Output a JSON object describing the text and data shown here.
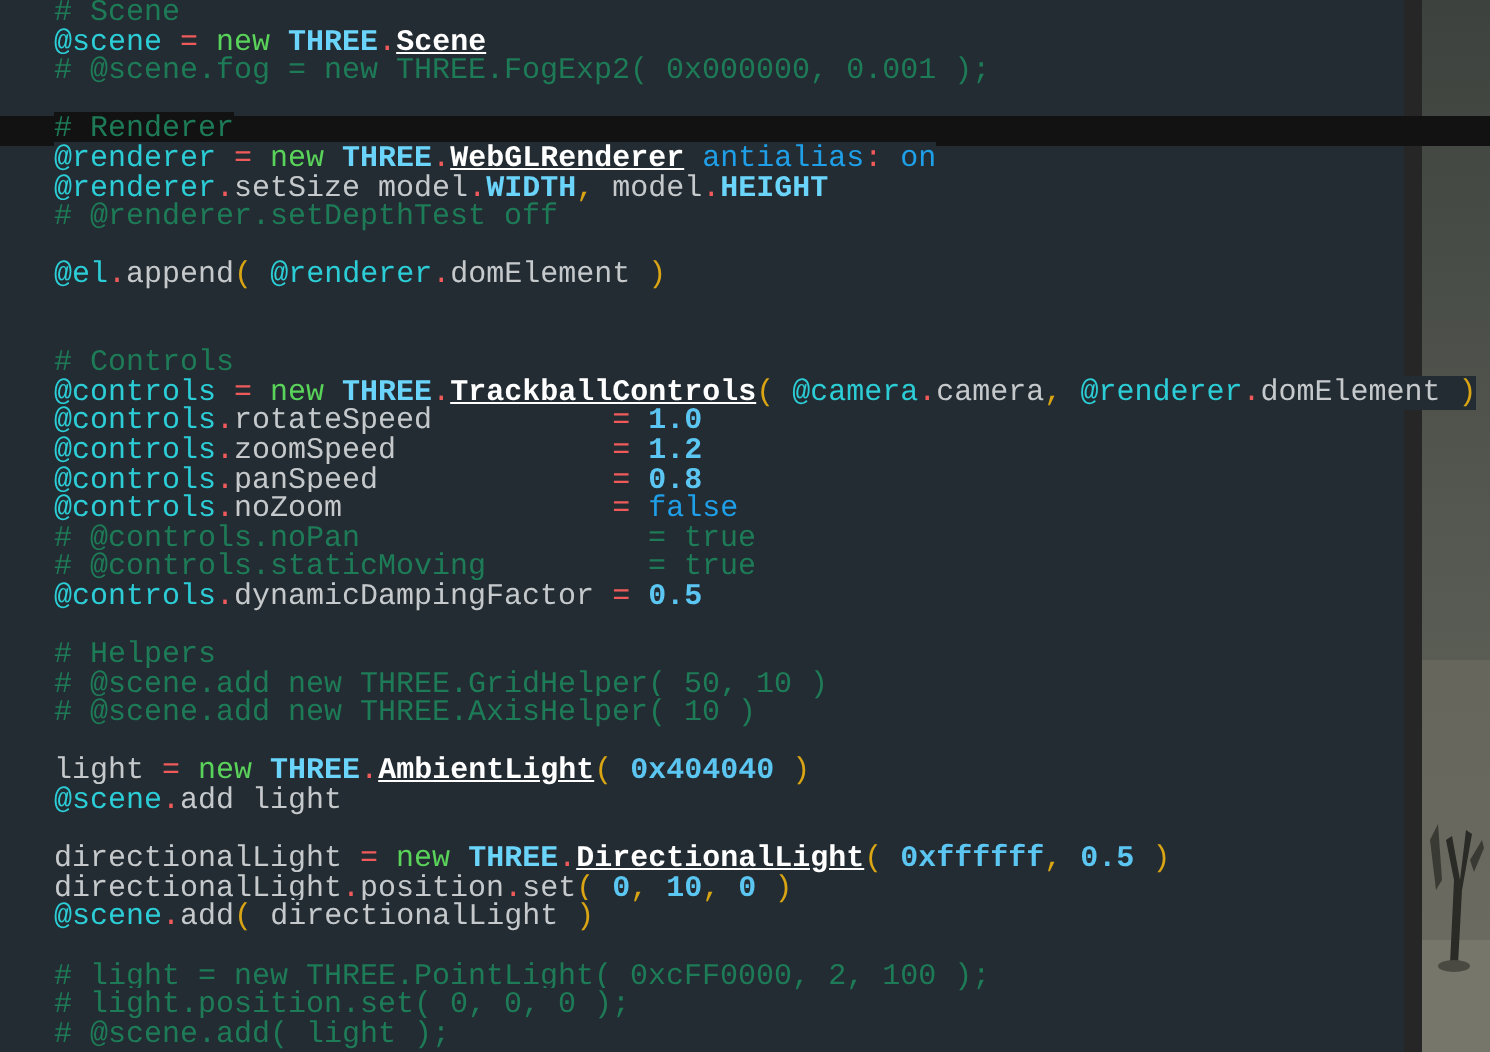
{
  "editor": {
    "lines": [
      {
        "kind": "code",
        "selected": false,
        "tokens": [
          {
            "text": "# Scene",
            "kind": "comment"
          }
        ]
      },
      {
        "kind": "code",
        "selected": false,
        "tokens": [
          {
            "text": "@scene",
            "kind": "ivar"
          },
          {
            "text": " = ",
            "kind": "op"
          },
          {
            "text": "new ",
            "kind": "new"
          },
          {
            "text": "THREE",
            "kind": "const"
          },
          {
            "text": ".",
            "kind": "op"
          },
          {
            "text": "Scene",
            "kind": "class"
          }
        ]
      },
      {
        "kind": "code",
        "selected": false,
        "tokens": [
          {
            "text": "# @scene.fog = new THREE.FogExp2( 0x000000, 0.001 );",
            "kind": "comment"
          }
        ]
      },
      {
        "kind": "blank",
        "selected": false
      },
      {
        "kind": "code",
        "selected": true,
        "tokens": [
          {
            "text": "# Renderer",
            "kind": "comment"
          }
        ]
      },
      {
        "kind": "code",
        "selected": false,
        "tokens": [
          {
            "text": "@renderer",
            "kind": "ivar"
          },
          {
            "text": " = ",
            "kind": "op"
          },
          {
            "text": "new ",
            "kind": "new"
          },
          {
            "text": "THREE",
            "kind": "const"
          },
          {
            "text": ".",
            "kind": "op"
          },
          {
            "text": "WebGLRenderer",
            "kind": "class"
          },
          {
            "text": " antialias",
            "kind": "keyword"
          },
          {
            "text": ": ",
            "kind": "op"
          },
          {
            "text": "on",
            "kind": "keyword"
          }
        ]
      },
      {
        "kind": "code",
        "selected": false,
        "tokens": [
          {
            "text": "@renderer",
            "kind": "ivar"
          },
          {
            "text": ".",
            "kind": "op"
          },
          {
            "text": "setSize model",
            "kind": "plain"
          },
          {
            "text": ".",
            "kind": "op"
          },
          {
            "text": "WIDTH",
            "kind": "const"
          },
          {
            "text": ", ",
            "kind": "punct"
          },
          {
            "text": "model",
            "kind": "plain"
          },
          {
            "text": ".",
            "kind": "op"
          },
          {
            "text": "HEIGHT",
            "kind": "const"
          }
        ]
      },
      {
        "kind": "code",
        "selected": false,
        "tokens": [
          {
            "text": "# @renderer.setDepthTest off",
            "kind": "comment"
          }
        ]
      },
      {
        "kind": "blank",
        "selected": false
      },
      {
        "kind": "code",
        "selected": false,
        "tokens": [
          {
            "text": "@el",
            "kind": "ivar"
          },
          {
            "text": ".",
            "kind": "op"
          },
          {
            "text": "append",
            "kind": "plain"
          },
          {
            "text": "( ",
            "kind": "punct"
          },
          {
            "text": "@renderer",
            "kind": "ivar"
          },
          {
            "text": ".",
            "kind": "op"
          },
          {
            "text": "domElement ",
            "kind": "plain"
          },
          {
            "text": ")",
            "kind": "punct"
          }
        ]
      },
      {
        "kind": "blank",
        "selected": false
      },
      {
        "kind": "blank",
        "selected": false
      },
      {
        "kind": "code",
        "selected": false,
        "tokens": [
          {
            "text": "# Controls",
            "kind": "comment"
          }
        ]
      },
      {
        "kind": "code",
        "selected": false,
        "tokens": [
          {
            "text": "@controls",
            "kind": "ivar"
          },
          {
            "text": " = ",
            "kind": "op"
          },
          {
            "text": "new ",
            "kind": "new"
          },
          {
            "text": "THREE",
            "kind": "const"
          },
          {
            "text": ".",
            "kind": "op"
          },
          {
            "text": "TrackballControls",
            "kind": "class"
          },
          {
            "text": "( ",
            "kind": "punct"
          },
          {
            "text": "@camera",
            "kind": "ivar"
          },
          {
            "text": ".",
            "kind": "op"
          },
          {
            "text": "camera",
            "kind": "plain"
          },
          {
            "text": ", ",
            "kind": "punct"
          },
          {
            "text": "@renderer",
            "kind": "ivar"
          },
          {
            "text": ".",
            "kind": "op"
          },
          {
            "text": "domElement ",
            "kind": "plain"
          },
          {
            "text": ")",
            "kind": "punct"
          }
        ]
      },
      {
        "kind": "code",
        "selected": false,
        "tokens": [
          {
            "text": "@controls",
            "kind": "ivar"
          },
          {
            "text": ".",
            "kind": "op"
          },
          {
            "text": "rotateSpeed          ",
            "kind": "plain"
          },
          {
            "text": "= ",
            "kind": "op"
          },
          {
            "text": "1.0",
            "kind": "number"
          }
        ]
      },
      {
        "kind": "code",
        "selected": false,
        "tokens": [
          {
            "text": "@controls",
            "kind": "ivar"
          },
          {
            "text": ".",
            "kind": "op"
          },
          {
            "text": "zoomSpeed            ",
            "kind": "plain"
          },
          {
            "text": "= ",
            "kind": "op"
          },
          {
            "text": "1.2",
            "kind": "number"
          }
        ]
      },
      {
        "kind": "code",
        "selected": false,
        "tokens": [
          {
            "text": "@controls",
            "kind": "ivar"
          },
          {
            "text": ".",
            "kind": "op"
          },
          {
            "text": "panSpeed             ",
            "kind": "plain"
          },
          {
            "text": "= ",
            "kind": "op"
          },
          {
            "text": "0.8",
            "kind": "number"
          }
        ]
      },
      {
        "kind": "code",
        "selected": false,
        "tokens": [
          {
            "text": "@controls",
            "kind": "ivar"
          },
          {
            "text": ".",
            "kind": "op"
          },
          {
            "text": "noZoom               ",
            "kind": "plain"
          },
          {
            "text": "= ",
            "kind": "op"
          },
          {
            "text": "false",
            "kind": "keyword"
          }
        ]
      },
      {
        "kind": "code",
        "selected": false,
        "tokens": [
          {
            "text": "# @controls.noPan                = true",
            "kind": "comment"
          }
        ]
      },
      {
        "kind": "code",
        "selected": false,
        "tokens": [
          {
            "text": "# @controls.staticMoving         = true",
            "kind": "comment"
          }
        ]
      },
      {
        "kind": "code",
        "selected": false,
        "tokens": [
          {
            "text": "@controls",
            "kind": "ivar"
          },
          {
            "text": ".",
            "kind": "op"
          },
          {
            "text": "dynamicDampingFactor ",
            "kind": "plain"
          },
          {
            "text": "= ",
            "kind": "op"
          },
          {
            "text": "0.5",
            "kind": "number"
          }
        ]
      },
      {
        "kind": "blank",
        "selected": false
      },
      {
        "kind": "code",
        "selected": false,
        "tokens": [
          {
            "text": "# Helpers",
            "kind": "comment"
          }
        ]
      },
      {
        "kind": "code",
        "selected": false,
        "tokens": [
          {
            "text": "# @scene.add new THREE.GridHelper( 50, 10 )",
            "kind": "comment"
          }
        ]
      },
      {
        "kind": "code",
        "selected": false,
        "tokens": [
          {
            "text": "# @scene.add new THREE.AxisHelper( 10 )",
            "kind": "comment"
          }
        ]
      },
      {
        "kind": "blank",
        "selected": false
      },
      {
        "kind": "code",
        "selected": false,
        "tokens": [
          {
            "text": "light ",
            "kind": "plain"
          },
          {
            "text": "= ",
            "kind": "op"
          },
          {
            "text": "new ",
            "kind": "new"
          },
          {
            "text": "THREE",
            "kind": "const"
          },
          {
            "text": ".",
            "kind": "op"
          },
          {
            "text": "AmbientLight",
            "kind": "class"
          },
          {
            "text": "( ",
            "kind": "punct"
          },
          {
            "text": "0x404040 ",
            "kind": "number"
          },
          {
            "text": ")",
            "kind": "punct"
          }
        ]
      },
      {
        "kind": "code",
        "selected": false,
        "tokens": [
          {
            "text": "@scene",
            "kind": "ivar"
          },
          {
            "text": ".",
            "kind": "op"
          },
          {
            "text": "add light",
            "kind": "plain"
          }
        ]
      },
      {
        "kind": "blank",
        "selected": false
      },
      {
        "kind": "code",
        "selected": false,
        "tokens": [
          {
            "text": "directionalLight ",
            "kind": "plain"
          },
          {
            "text": "= ",
            "kind": "op"
          },
          {
            "text": "new ",
            "kind": "new"
          },
          {
            "text": "THREE",
            "kind": "const"
          },
          {
            "text": ".",
            "kind": "op"
          },
          {
            "text": "DirectionalLight",
            "kind": "class"
          },
          {
            "text": "( ",
            "kind": "punct"
          },
          {
            "text": "0xffffff",
            "kind": "number"
          },
          {
            "text": ", ",
            "kind": "punct"
          },
          {
            "text": "0.5 ",
            "kind": "number"
          },
          {
            "text": ")",
            "kind": "punct"
          }
        ]
      },
      {
        "kind": "code",
        "selected": false,
        "tokens": [
          {
            "text": "directionalLight",
            "kind": "plain"
          },
          {
            "text": ".",
            "kind": "op"
          },
          {
            "text": "position",
            "kind": "plain"
          },
          {
            "text": ".",
            "kind": "op"
          },
          {
            "text": "set",
            "kind": "plain"
          },
          {
            "text": "( ",
            "kind": "punct"
          },
          {
            "text": "0",
            "kind": "number"
          },
          {
            "text": ", ",
            "kind": "punct"
          },
          {
            "text": "10",
            "kind": "number"
          },
          {
            "text": ", ",
            "kind": "punct"
          },
          {
            "text": "0 ",
            "kind": "number"
          },
          {
            "text": ")",
            "kind": "punct"
          }
        ]
      },
      {
        "kind": "code",
        "selected": false,
        "tokens": [
          {
            "text": "@scene",
            "kind": "ivar"
          },
          {
            "text": ".",
            "kind": "op"
          },
          {
            "text": "add",
            "kind": "plain"
          },
          {
            "text": "( ",
            "kind": "punct"
          },
          {
            "text": "directionalLight ",
            "kind": "plain"
          },
          {
            "text": ")",
            "kind": "punct"
          }
        ]
      },
      {
        "kind": "blank",
        "selected": false
      },
      {
        "kind": "code",
        "selected": false,
        "tokens": [
          {
            "text": "# light = new THREE.PointLight( 0xcFF0000, 2, 100 );",
            "kind": "comment"
          }
        ]
      },
      {
        "kind": "code",
        "selected": false,
        "tokens": [
          {
            "text": "# light.position.set( 0, 0, 0 );",
            "kind": "comment"
          }
        ]
      },
      {
        "kind": "code",
        "selected": false,
        "tokens": [
          {
            "text": "# @scene.add( light );",
            "kind": "comment"
          }
        ]
      }
    ]
  }
}
